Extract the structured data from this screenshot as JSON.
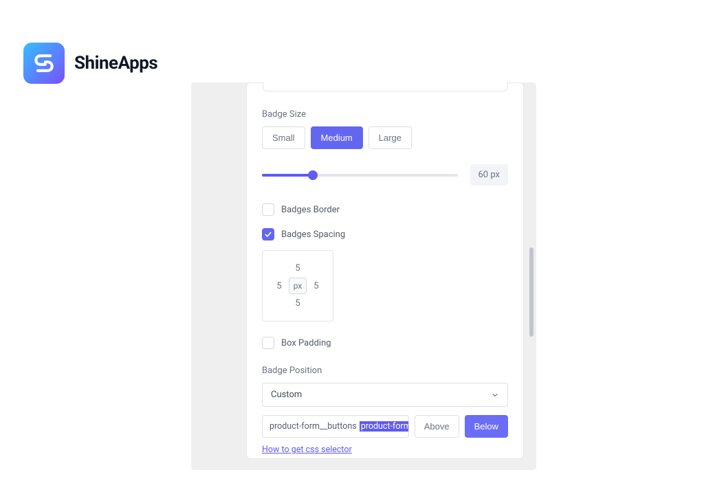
{
  "brand": {
    "name": "ShineApps"
  },
  "badge_size": {
    "label": "Badge Size",
    "options": [
      "Small",
      "Medium",
      "Large"
    ],
    "selected": "Medium",
    "slider_value": "60 px"
  },
  "badges_border": {
    "label": "Badges Border",
    "checked": false
  },
  "badges_spacing": {
    "label": "Badges Spacing",
    "checked": true,
    "top": "5",
    "right": "5",
    "bottom": "5",
    "left": "5",
    "unit": "px"
  },
  "box_padding": {
    "label": "Box Padding",
    "checked": false
  },
  "badge_position": {
    "label": "Badge Position",
    "selected": "Custom",
    "selector_prefix": "product-form__buttons ",
    "selector_highlight": "product-form_summit",
    "placement_options": [
      "Above",
      "Below"
    ],
    "placement_selected": "Below",
    "help_text": "How to get css selector"
  }
}
